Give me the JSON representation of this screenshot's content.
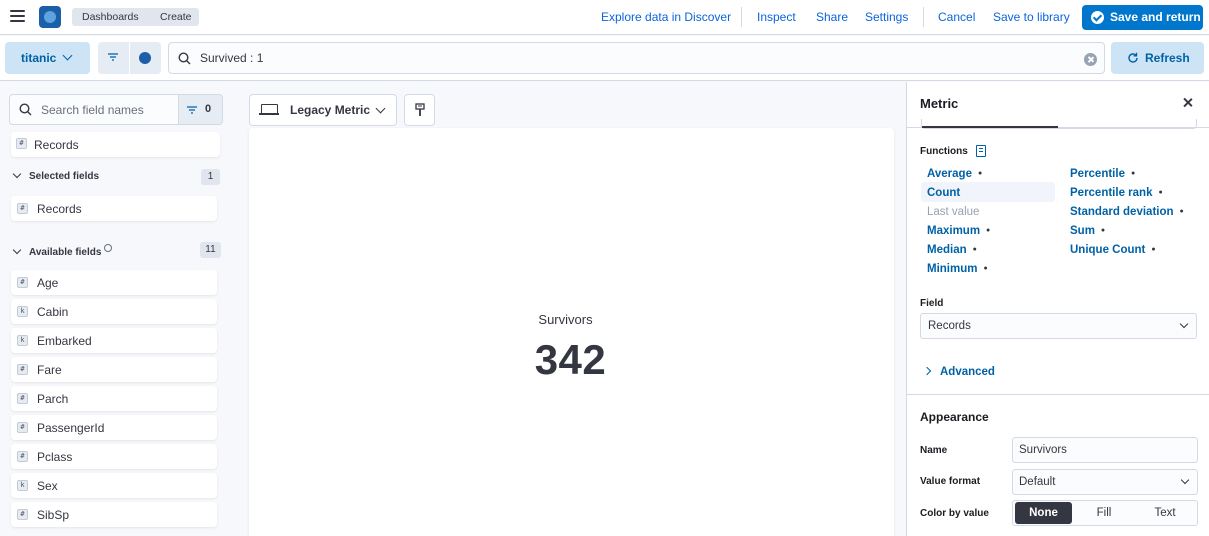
{
  "header": {
    "breadcrumbs": [
      "Dashboards",
      "Create"
    ],
    "links": {
      "explore": "Explore data in Discover",
      "inspect": "Inspect",
      "share": "Share",
      "settings": "Settings",
      "cancel": "Cancel",
      "save_library": "Save to library"
    },
    "save_return": "Save and return"
  },
  "querybar": {
    "data_view": "titanic",
    "query": "Survived : 1",
    "refresh": "Refresh"
  },
  "fields": {
    "search_placeholder": "Search field names",
    "filter_count": "0",
    "records_top": "Records",
    "selected_title": "Selected fields",
    "selected_count": "1",
    "selected": [
      {
        "name": "Records",
        "type": "#"
      }
    ],
    "available_title": "Available fields",
    "available_count": "11",
    "available": [
      {
        "name": "Age",
        "type": "#"
      },
      {
        "name": "Cabin",
        "type": "k"
      },
      {
        "name": "Embarked",
        "type": "k"
      },
      {
        "name": "Fare",
        "type": "#"
      },
      {
        "name": "Parch",
        "type": "#"
      },
      {
        "name": "PassengerId",
        "type": "#"
      },
      {
        "name": "Pclass",
        "type": "#"
      },
      {
        "name": "Sex",
        "type": "k"
      },
      {
        "name": "SibSp",
        "type": "#"
      }
    ]
  },
  "workspace": {
    "vis_type": "Legacy Metric",
    "metric_label": "Survivors",
    "metric_value": "342"
  },
  "panel": {
    "title": "Metric",
    "functions_label": "Functions",
    "functions_left": [
      "Average",
      "Count",
      "Last value",
      "Maximum",
      "Median",
      "Minimum"
    ],
    "functions_right": [
      "Percentile",
      "Percentile rank",
      "Standard deviation",
      "Sum",
      "Unique Count"
    ],
    "selected_function": "Count",
    "field_label": "Field",
    "field_value": "Records",
    "advanced": "Advanced",
    "appearance": "Appearance",
    "name_label": "Name",
    "name_value": "Survivors",
    "value_format_label": "Value format",
    "value_format": "Default",
    "color_by_value_label": "Color by value",
    "color_options": [
      "None",
      "Fill",
      "Text"
    ],
    "color_selected": "None"
  },
  "colors": {
    "primary": "#0077cc",
    "link": "#0b64dd",
    "accent_light": "#cce4f5"
  }
}
